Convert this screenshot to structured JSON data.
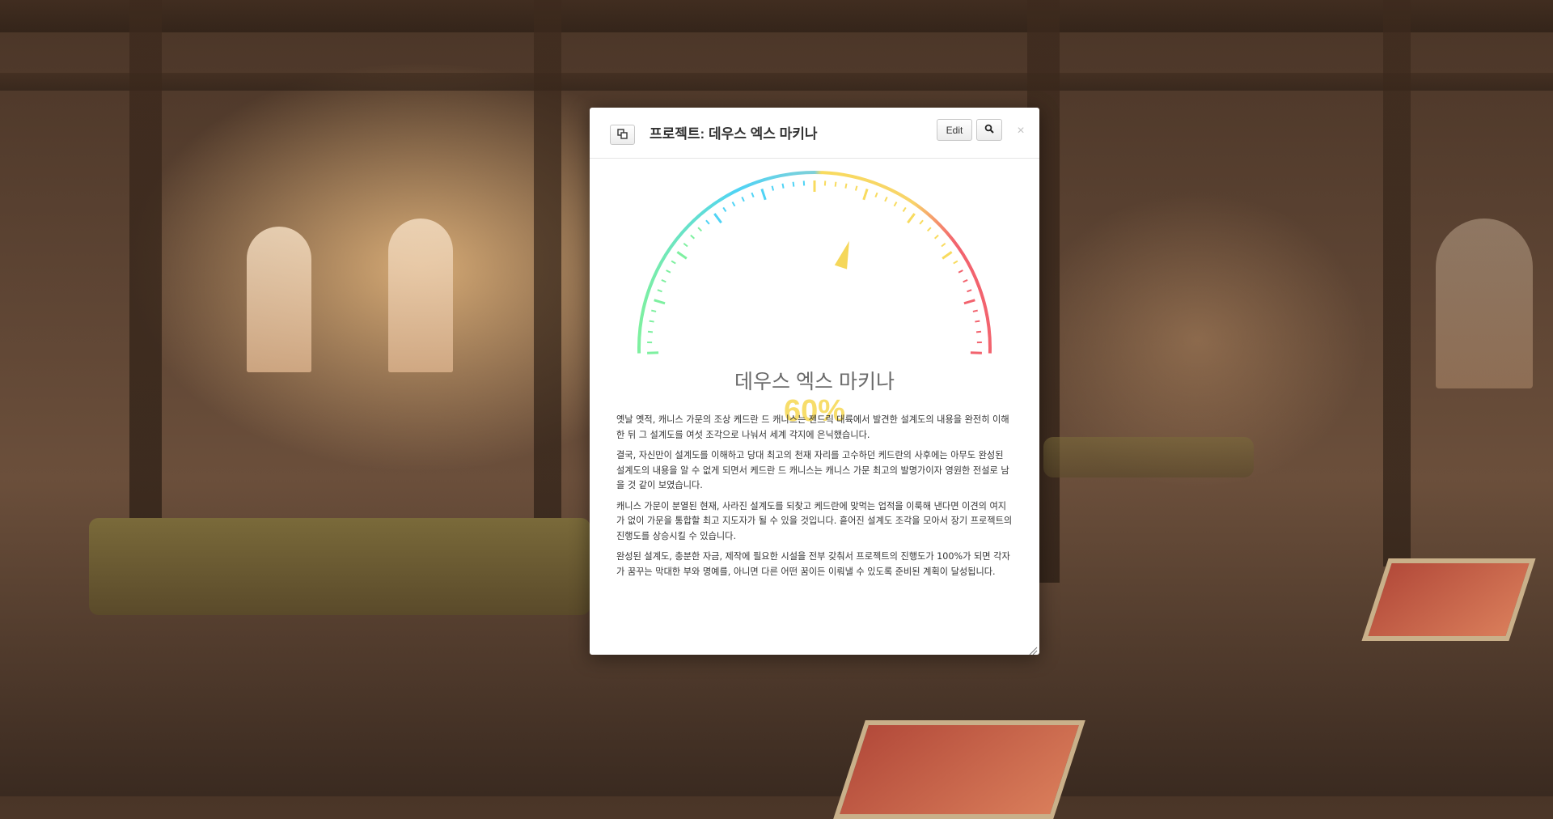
{
  "modal": {
    "title": "프로젝트: 데우스 엑스 마키나",
    "edit_label": "Edit",
    "close_label": "×",
    "copy_icon": "copy-icon",
    "search_icon": "search-icon"
  },
  "gauge": {
    "name": "데우스 엑스 마키나",
    "percent_label": "60%",
    "value_percent": 60,
    "colors": {
      "green": "#7ef0a0",
      "cyan": "#4fd3f5",
      "yellow": "#f8db5e",
      "red": "#f2636e",
      "needle": "#f5d75a",
      "percent_text": "#f7dd6b"
    }
  },
  "content": {
    "paragraphs": [
      "옛날 옛적, 캐니스 가문의 조상 케드란 드 캐니스는 젠드릭 대륙에서 발견한 설계도의 내용을 완전히 이해한 뒤 그 설계도를 여섯 조각으로 나눠서 세계 각지에 은닉했습니다.",
      "결국, 자신만이 설계도를 이해하고 당대 최고의 천재 자리를 고수하던 케드란의 사후에는 아무도 완성된 설계도의 내용을 알 수 없게 되면서 케드란 드 캐니스는 캐니스 가문 최고의 발명가이자 영원한 전설로 남을 것 같이 보였습니다.",
      "캐니스 가문이 분열된 현재, 사라진 설계도를 되찾고 케드란에 맞먹는 업적을 이룩해 낸다면 이견의 여지가 없이 가문을 통합할 최고 지도자가 될 수 있을 것입니다. 흩어진 설계도 조각을 모아서 장기 프로젝트의 진행도를 상승시킬 수 있습니다.",
      "완성된 설계도, 충분한 자금, 제작에 필요한 시설을 전부 갖춰서 프로젝트의 진행도가 100%가 되면 각자가 꿈꾸는 막대한 부와 명예를, 아니면 다른 어떤 꿈이든 이뤄낼 수 있도록 준비된 계획이 달성됩니다."
    ]
  }
}
